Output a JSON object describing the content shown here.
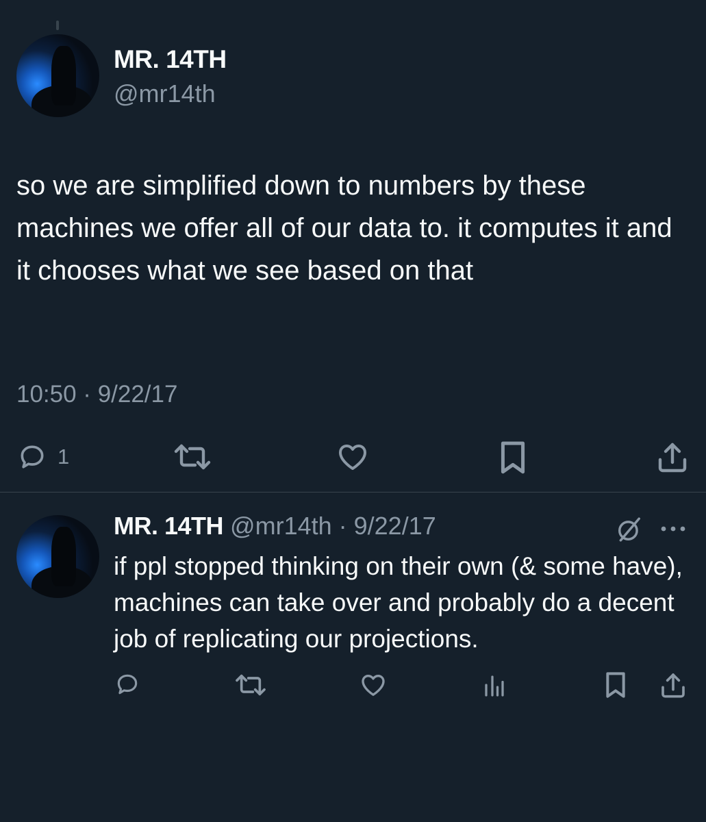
{
  "main_tweet": {
    "author_name": "MR. 14TH",
    "author_handle": "@mr14th",
    "text": "so we are simplified down to numbers by these machines we offer all of our data to. it computes it and it chooses what we see based on that",
    "timestamp": "10:50 · 9/22/17",
    "actions": {
      "reply_count": "1",
      "reply_icon": "reply-icon",
      "retweet_icon": "retweet-icon",
      "like_icon": "like-icon",
      "bookmark_icon": "bookmark-icon",
      "share_icon": "share-icon"
    }
  },
  "reply_tweet": {
    "author_name": "MR. 14TH",
    "handle_date": "@mr14th · 9/22/17",
    "text": "if ppl stopped thinking on their own (& some have), machines can take over and probably do a decent job of replicating our projections.",
    "header_icons": [
      "grok-icon",
      "more-icon"
    ],
    "actions": [
      "reply-icon",
      "retweet-icon",
      "like-icon",
      "views-icon",
      "bookmark-icon",
      "share-icon"
    ]
  },
  "colors": {
    "background": "#15202b",
    "text_primary": "#f7f9f9",
    "text_secondary": "#8b98a5",
    "divider": "#38444d"
  }
}
